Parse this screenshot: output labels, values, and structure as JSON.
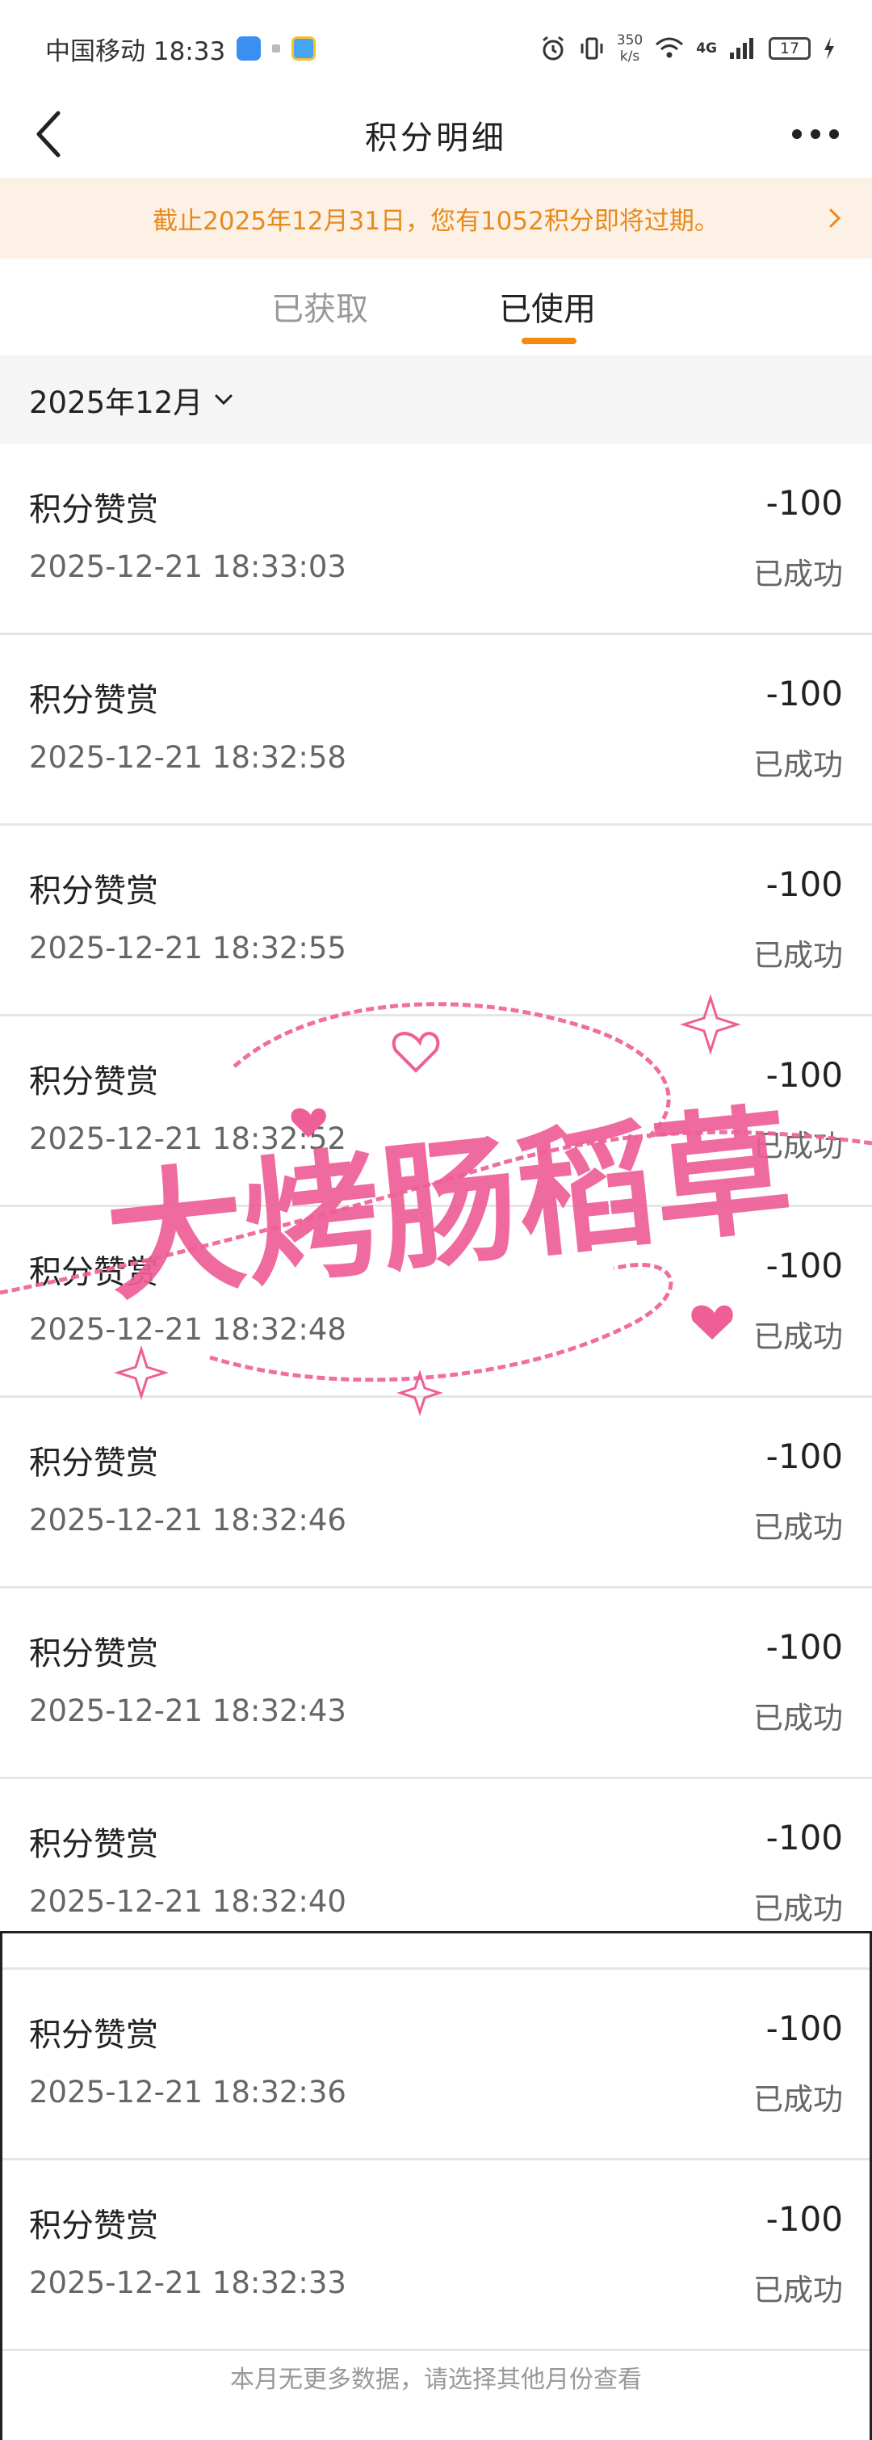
{
  "status_bar": {
    "carrier_time": "中国移动 18:33",
    "net_speed_value": "350",
    "net_speed_unit": "k/s",
    "network": "4G",
    "battery": "17"
  },
  "nav": {
    "title": "积分明细"
  },
  "banner": {
    "text": "截止2025年12月31日，您有1052积分即将过期。"
  },
  "tabs": [
    {
      "label": "已获取",
      "active": false
    },
    {
      "label": "已使用",
      "active": true
    }
  ],
  "month_selector": {
    "label": "2025年12月"
  },
  "records": [
    {
      "title": "积分赞赏",
      "time": "2025-12-21 18:33:03",
      "amount": "-100",
      "status": "已成功"
    },
    {
      "title": "积分赞赏",
      "time": "2025-12-21 18:32:58",
      "amount": "-100",
      "status": "已成功"
    },
    {
      "title": "积分赞赏",
      "time": "2025-12-21 18:32:55",
      "amount": "-100",
      "status": "已成功"
    },
    {
      "title": "积分赞赏",
      "time": "2025-12-21 18:32:52",
      "amount": "-100",
      "status": "已成功"
    },
    {
      "title": "积分赞赏",
      "time": "2025-12-21 18:32:48",
      "amount": "-100",
      "status": "已成功"
    },
    {
      "title": "积分赞赏",
      "time": "2025-12-21 18:32:46",
      "amount": "-100",
      "status": "已成功"
    },
    {
      "title": "积分赞赏",
      "time": "2025-12-21 18:32:43",
      "amount": "-100",
      "status": "已成功"
    },
    {
      "title": "积分赞赏",
      "time": "2025-12-21 18:32:40",
      "amount": "-100",
      "status": "已成功"
    },
    {
      "title": "积分赞赏",
      "time": "2025-12-21 18:32:36",
      "amount": "-100",
      "status": "已成功"
    },
    {
      "title": "积分赞赏",
      "time": "2025-12-21 18:32:33",
      "amount": "-100",
      "status": "已成功"
    }
  ],
  "footer": {
    "text": "本月无更多数据，请选择其他月份查看"
  },
  "watermark": {
    "text": "大烤肠稻草",
    "color": "#ee5f97"
  },
  "colors": {
    "accent": "#f08a10",
    "banner_bg": "#fdf1e5",
    "banner_text": "#e78a1e"
  }
}
